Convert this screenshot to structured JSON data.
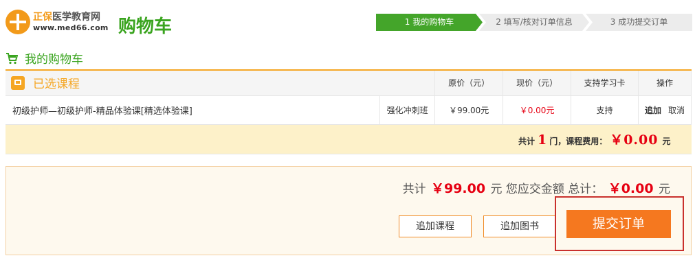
{
  "logo": {
    "brand_highlight": "正保",
    "brand_rest": "医学教育网",
    "url": "www.med66.com"
  },
  "page_title": "购物车",
  "steps": [
    "1  我的购物车",
    "2  填写/核对订单信息",
    "3  成功提交订单"
  ],
  "section_title": "我的购物车",
  "table": {
    "selected_label": "已选课程",
    "headers": [
      "原价（元）",
      "现价（元）",
      "支持学习卡",
      "操作"
    ],
    "rows": [
      {
        "name": "初级护师—初级护师-精品体验课[精选体验课]",
        "class_type": "强化冲刺班",
        "original_price": "￥99.00元",
        "current_price": "￥0.00元",
        "study_card": "支持",
        "action_add": "追加",
        "action_cancel": "取消"
      }
    ]
  },
  "summary": {
    "prefix": "共计",
    "count": "1",
    "middle": "门，课程费用：",
    "fee": "￥0.00",
    "unit": "元"
  },
  "bottom": {
    "total_prefix": "共计",
    "total_amount": "￥99.00",
    "total_mid": "元  您应交金额 总计：",
    "payable_amount": "￥0.00",
    "unit": "元",
    "add_course_label": "追加课程",
    "add_book_label": "追加图书",
    "submit_label": "提交订单"
  },
  "colors": {
    "green": "#3aa41f",
    "orange": "#f5a623",
    "red": "#e60012",
    "submit": "#f5781f"
  },
  "icons": [
    "logo-icon",
    "cart-icon",
    "selected-courses-icon"
  ]
}
